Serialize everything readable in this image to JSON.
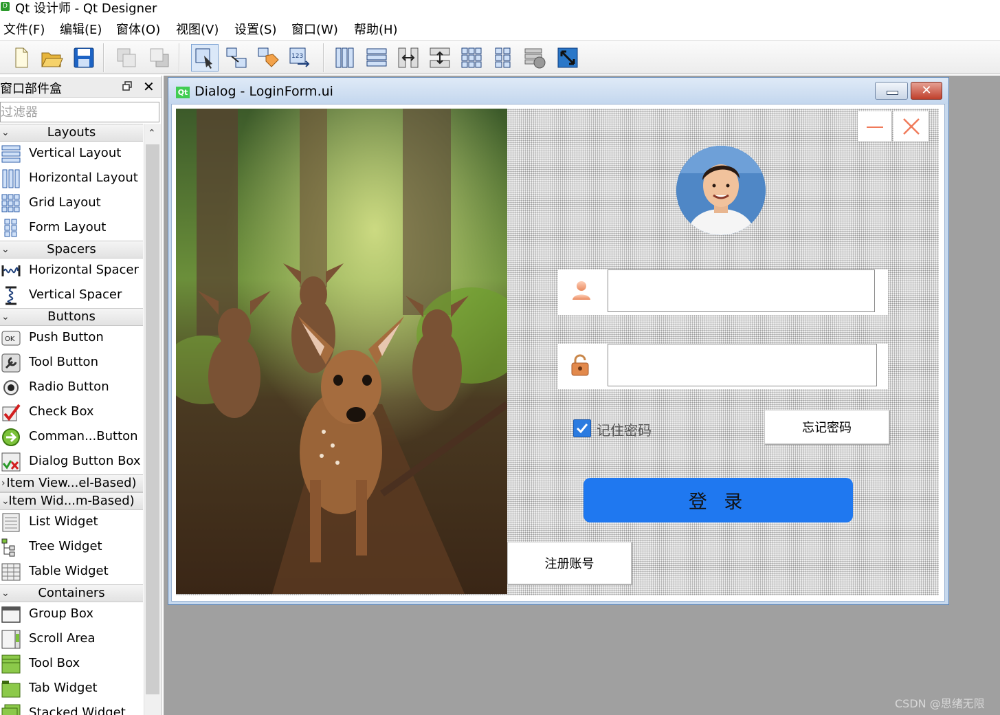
{
  "app": {
    "window_title": "Qt 设计师 - Qt Designer"
  },
  "menu": [
    "文件(F)",
    "编辑(E)",
    "窗体(O)",
    "视图(V)",
    "设置(S)",
    "窗口(W)",
    "帮助(H)"
  ],
  "toolbar": {
    "buttons": [
      "new-file",
      "open-file",
      "save-file",
      "send-to-back",
      "bring-to-front",
      "edit-widgets",
      "edit-signals-slots",
      "edit-buddies",
      "edit-tab-order",
      "lay-out-horizontally",
      "lay-out-vertically",
      "lay-out-horizontal-splitter",
      "lay-out-vertical-splitter",
      "lay-out-grid",
      "lay-out-form",
      "break-layout",
      "adjust-size"
    ],
    "active": "edit-widgets"
  },
  "widget_box": {
    "title": "窗口部件盒",
    "filter_placeholder": "过滤器",
    "categories": {
      "layouts": "Layouts",
      "spacers": "Spacers",
      "buttons": "Buttons",
      "item_views": "Item View...el-Based)",
      "item_widgets": "Item Wid...m-Based)",
      "containers": "Containers"
    },
    "items": {
      "vertical_layout": "Vertical Layout",
      "horizontal_layout": "Horizontal Layout",
      "grid_layout": "Grid Layout",
      "form_layout": "Form Layout",
      "horizontal_spacer": "Horizontal Spacer",
      "vertical_spacer": "Vertical Spacer",
      "push_button": "Push Button",
      "tool_button": "Tool Button",
      "radio_button": "Radio Button",
      "check_box": "Check Box",
      "command_link_button": "Comman...Button",
      "dialog_button_box": "Dialog Button Box",
      "list_widget": "List Widget",
      "tree_widget": "Tree Widget",
      "table_widget": "Table Widget",
      "group_box": "Group Box",
      "scroll_area": "Scroll Area",
      "tool_box": "Tool Box",
      "tab_widget": "Tab Widget",
      "stacked_widget": "Stacked Widget"
    }
  },
  "dialog": {
    "title": "Dialog - LoginForm.ui",
    "qt_badge": "Qt",
    "username_value": "",
    "password_value": "",
    "remember_label": "记住密码",
    "remember_checked": true,
    "forgot_label": "忘记密码",
    "login_label": "登 录",
    "register_label": "注册账号"
  },
  "colors": {
    "accent": "#1f78f0",
    "close_red": "#f07a5a",
    "mdi_background": "#a0a0a0"
  },
  "watermark": "CSDN @思绪无限"
}
